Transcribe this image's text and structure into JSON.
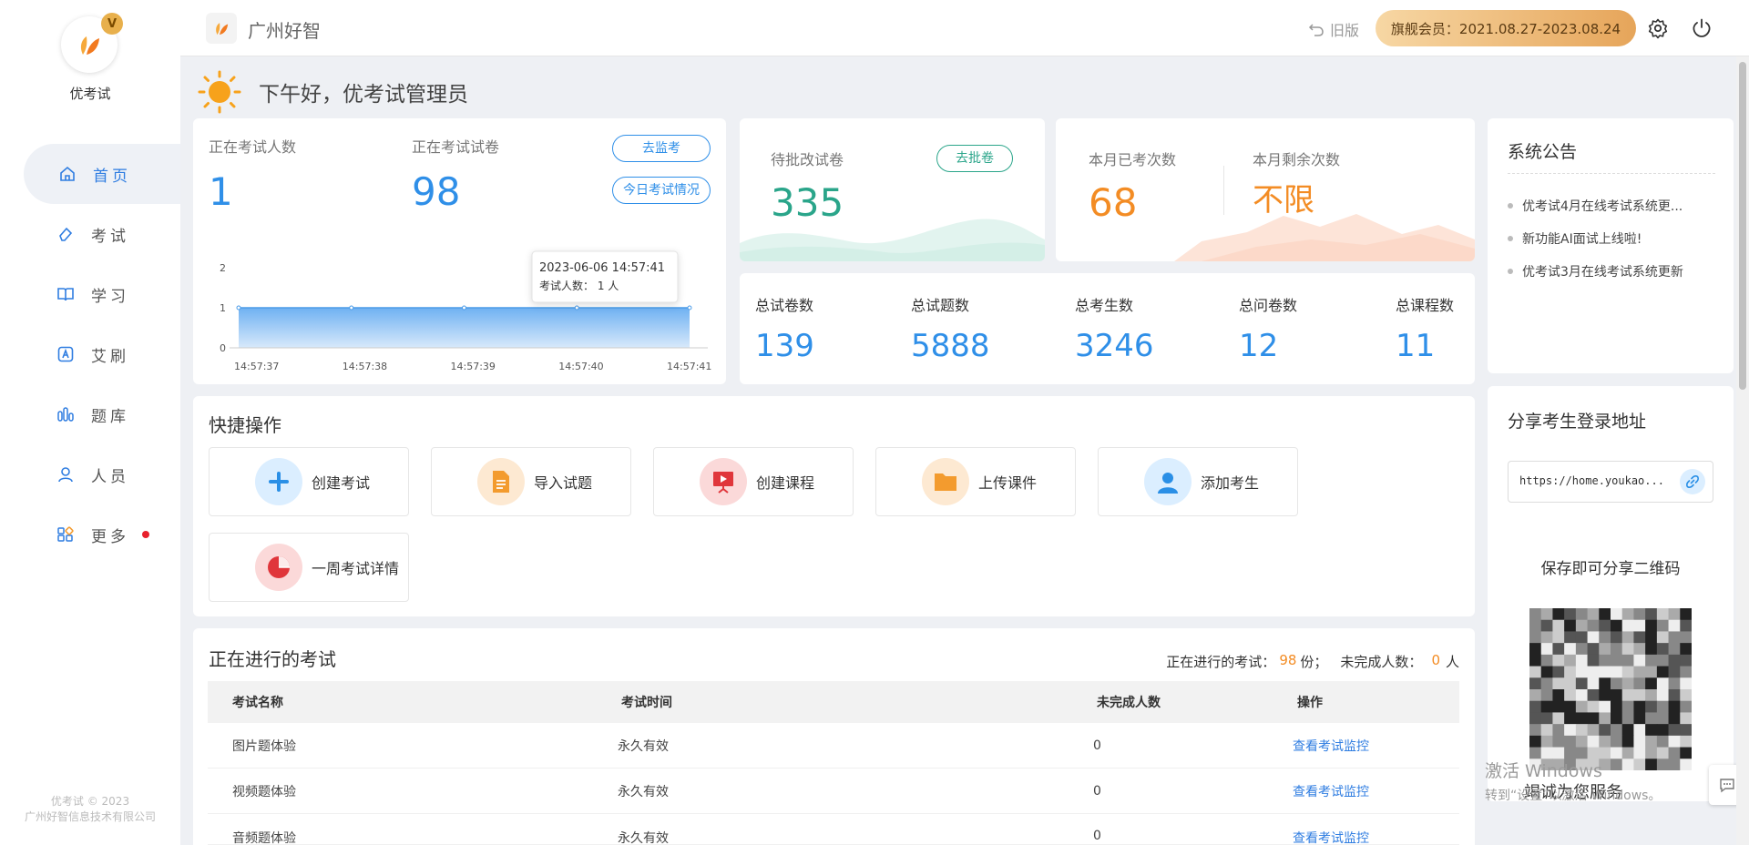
{
  "sidebar": {
    "brand": "优考试",
    "vip_badge": "V",
    "items": [
      {
        "label": "首页"
      },
      {
        "label": "考试"
      },
      {
        "label": "学习"
      },
      {
        "label": "艾刷"
      },
      {
        "label": "题库"
      },
      {
        "label": "人员"
      },
      {
        "label": "更多"
      }
    ],
    "footer_line1": "优考试 © 2023",
    "footer_line2": "广州好智信息技术有限公司"
  },
  "topbar": {
    "org": "广州好智",
    "old_version": "旧版",
    "member": "旗舰会员：2021.08.27-2023.08.24"
  },
  "greeting": "下午好，优考试管理员",
  "live": {
    "examinees_label": "正在考试人数",
    "examinees_value": "1",
    "papers_label": "正在考试试卷",
    "papers_value": "98",
    "monitor_btn": "去监考",
    "today_btn": "今日考试情况"
  },
  "chart_data": {
    "type": "area",
    "x": [
      "14:57:37",
      "14:57:38",
      "14:57:39",
      "14:57:40",
      "14:57:41"
    ],
    "values": [
      1,
      1,
      1,
      1,
      1
    ],
    "ylim": [
      0,
      2
    ],
    "yticks": [
      "0",
      "1",
      "2"
    ],
    "grid": false,
    "tooltip_title": "2023-06-06 14:57:41",
    "tooltip_body": "考试人数： 1 人"
  },
  "grading": {
    "label": "待批改试卷",
    "value": "335",
    "button": "去批卷"
  },
  "monthly": {
    "used_label": "本月已考次数",
    "used_value": "68",
    "remain_label": "本月剩余次数",
    "remain_value": "不限"
  },
  "totals": [
    {
      "label": "总试卷数",
      "value": "139"
    },
    {
      "label": "总试题数",
      "value": "5888"
    },
    {
      "label": "总考生数",
      "value": "3246"
    },
    {
      "label": "总问卷数",
      "value": "12"
    },
    {
      "label": "总课程数",
      "value": "11"
    }
  ],
  "notice": {
    "title": "系统公告",
    "items": [
      "优考试4月在线考试系统更...",
      "新功能AI面试上线啦!",
      "优考试3月在线考试系统更新"
    ]
  },
  "quick": {
    "title": "快捷操作",
    "items": [
      {
        "label": "创建考试",
        "icon": "plus-icon",
        "color": "#2a8fe6",
        "bg": "#dbeeff"
      },
      {
        "label": "导入试题",
        "icon": "document-icon",
        "color": "#f39b2e",
        "bg": "#fde9d2"
      },
      {
        "label": "创建课程",
        "icon": "presentation-icon",
        "color": "#e0363b",
        "bg": "#fbd9d9"
      },
      {
        "label": "上传课件",
        "icon": "folder-icon",
        "color": "#f39b2e",
        "bg": "#fde9d2"
      },
      {
        "label": "添加考生",
        "icon": "user-icon",
        "color": "#2a8fe6",
        "bg": "#dbeeff"
      },
      {
        "label": "一周考试详情",
        "icon": "pie-chart-icon",
        "color": "#e0363b",
        "bg": "#fbd9d9"
      }
    ]
  },
  "share": {
    "title": "分享考生登录地址",
    "url": "https://home.youkao...",
    "qr_caption": "保存即可分享二维码",
    "bottom_text": "竭诚为您服务"
  },
  "ongoing": {
    "title": "正在进行的考试",
    "summary_prefix": "正在进行的考试：",
    "count": "98",
    "count_unit": "份；",
    "unfinished_prefix": "未完成人数：",
    "unfinished": "0",
    "unfinished_unit": "人",
    "columns": [
      "考试名称",
      "考试时间",
      "未完成人数",
      "操作"
    ],
    "rows": [
      {
        "name": "图片题体验",
        "time": "永久有效",
        "unfinished": "0",
        "action": "查看考试监控"
      },
      {
        "name": "视频题体验",
        "time": "永久有效",
        "unfinished": "0",
        "action": "查看考试监控"
      },
      {
        "name": "音频题体验",
        "time": "永久有效",
        "unfinished": "0",
        "action": "查看考试监控"
      }
    ]
  },
  "watermark": {
    "line1": "激活 Windows",
    "line2": "转到“设置”以激活 Windows。"
  },
  "colors": {
    "blue": "#2f8fe8",
    "green": "#2aa58a",
    "orange": "#f38c24"
  }
}
